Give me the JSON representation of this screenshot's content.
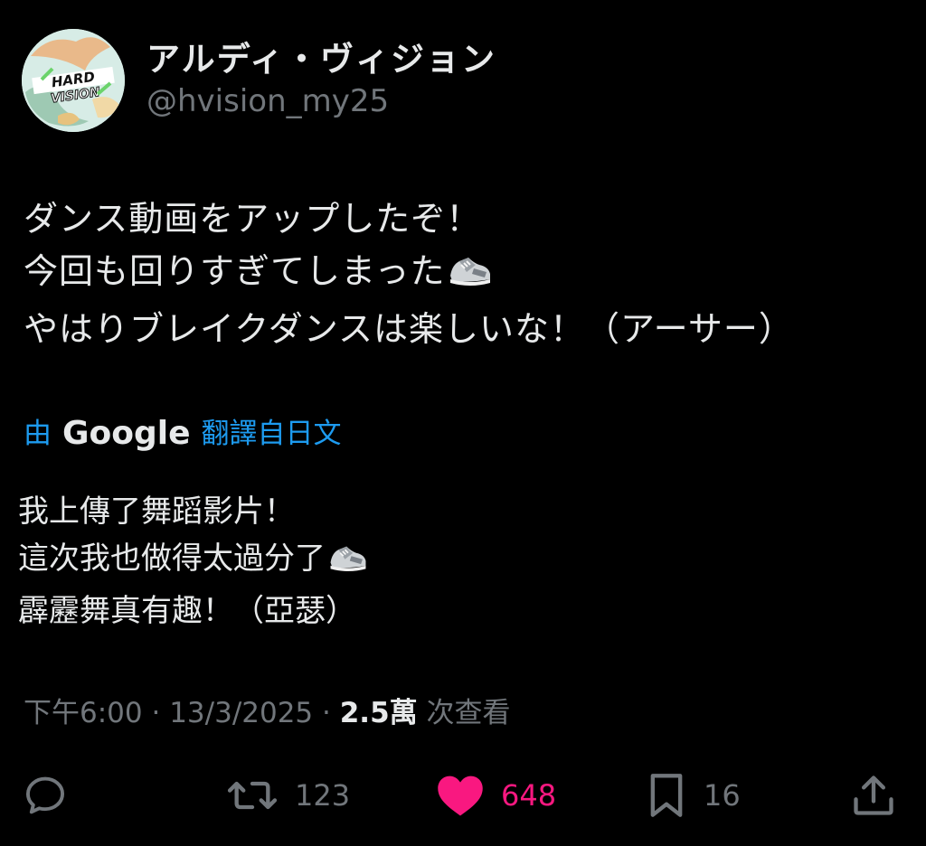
{
  "author": {
    "display_name": "アルディ・ヴィジョン",
    "handle": "@hvision_my25",
    "avatar_logo_text": "HARD/VISION"
  },
  "tweet": {
    "lines": [
      "ダンス動画をアップしたぞ！",
      "今回も回りすぎてしまった",
      "やはりブレイクダンスは楽しいな！（アーサー）"
    ]
  },
  "translation": {
    "prefix": "由",
    "provider": "Google",
    "suffix": "翻譯自日文",
    "lines": [
      "我上傳了舞蹈影片！",
      "這次我也做得太過分了",
      "霹靂舞真有趣！（亞瑟）"
    ]
  },
  "meta": {
    "time": "下午6:00",
    "separator": "·",
    "date": "13/3/2025",
    "views_count": "2.5萬",
    "views_label": "次查看"
  },
  "actions": {
    "reply_count": "",
    "retweet_count": "123",
    "like_count": "648",
    "bookmark_count": "16"
  },
  "colors": {
    "background": "#000000",
    "text": "#e7e9ea",
    "muted": "#71767b",
    "link": "#1d9bf0",
    "like": "#f91880"
  },
  "icons": {
    "reply": "speech-bubble-icon",
    "retweet": "retweet-icon",
    "like": "heart-icon",
    "bookmark": "bookmark-icon",
    "share": "share-upload-icon",
    "emoji": "sneaker-emoji-icon"
  }
}
